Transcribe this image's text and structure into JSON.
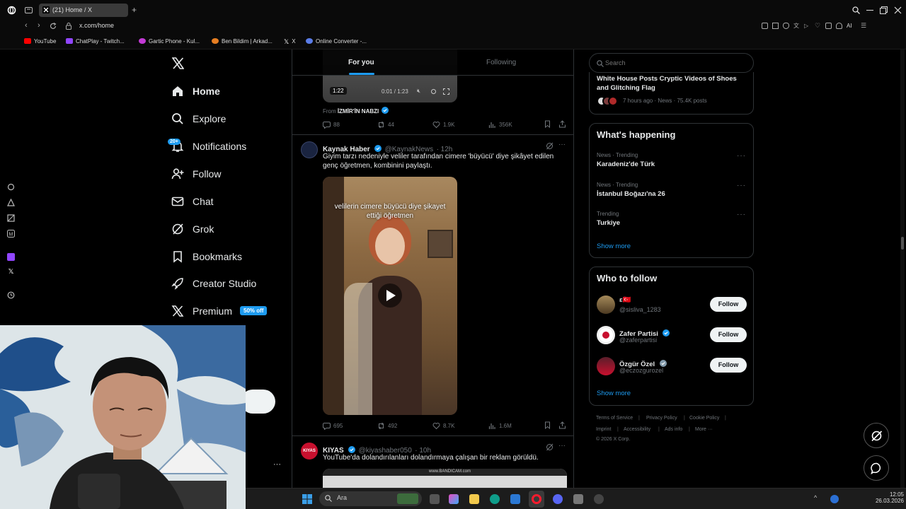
{
  "browser": {
    "tab_title": "(21) Home / X",
    "url": "x.com/home",
    "bookmarks": [
      "YouTube",
      "ChatPlay - Twitch...",
      "Gartic Phone - Kul...",
      "Ben Bildim | Arkad...",
      "X",
      "Online Converter -..."
    ]
  },
  "nav": {
    "items": [
      {
        "label": "Home",
        "icon": "home-icon"
      },
      {
        "label": "Explore",
        "icon": "search-icon"
      },
      {
        "label": "Notifications",
        "icon": "bell-icon",
        "badge": "20+"
      },
      {
        "label": "Follow",
        "icon": "add-person-icon"
      },
      {
        "label": "Chat",
        "icon": "envelope-icon"
      },
      {
        "label": "Grok",
        "icon": "grok-icon"
      },
      {
        "label": "Bookmarks",
        "icon": "bookmark-icon"
      },
      {
        "label": "Creator Studio",
        "icon": "rocket-icon"
      },
      {
        "label": "Premium",
        "icon": "x-logo-icon",
        "badge": "50% off"
      }
    ],
    "more": "···"
  },
  "feed": {
    "tabs": [
      "For you",
      "Following"
    ],
    "post1": {
      "video_duration": "1:22",
      "video_progress": "0:01 / 1:23",
      "from_label": "From",
      "from_source": "İZMİR'İN NABZI",
      "replies": "88",
      "reposts": "44",
      "likes": "1.9K",
      "views": "356K"
    },
    "post2": {
      "name": "Kaynak Haber",
      "handle": "@KaynakNews",
      "time": "· 12h",
      "text": "Giyim tarzı nedeniyle veliler tarafından cimere 'büyücü' diye şikâyet edilen genç öğretmen, kombinini paylaştı.",
      "video_caption": "velilerin cimere büyücü diye şikayet ettiği öğretmen",
      "replies": "695",
      "reposts": "492",
      "likes": "8.7K",
      "views": "1.6M"
    },
    "post3": {
      "name": "KIYAS",
      "avatar_text": "KIYAS",
      "handle": "@kiyashaber050",
      "time": "· 10h",
      "text": "YouTube'da dolandırılanları dolandırmaya çalışan bir reklam görüldü.",
      "image_text": "www.BANDICAM.com"
    }
  },
  "sidebar": {
    "search_placeholder": "Search",
    "top_news": {
      "title": "White House Posts Cryptic Videos of Shoes and Glitching Flag",
      "meta": "7 hours ago · News · 75.4K posts"
    },
    "happening": {
      "title": "What's happening",
      "trends": [
        {
          "meta": "News · Trending",
          "name": "Karadeniz'de Türk"
        },
        {
          "meta": "News · Trending",
          "name": "İstanbul Boğazı'na 26"
        },
        {
          "meta": "Trending",
          "name": "Turkiye"
        }
      ],
      "show_more": "Show more"
    },
    "who_to_follow": {
      "title": "Who to follow",
      "accounts": [
        {
          "name": "ε🇹🇷",
          "handle": "@sisliva_1283",
          "button": "Follow"
        },
        {
          "name": "Zafer Partisi",
          "handle": "@zaferpartisi",
          "button": "Follow"
        },
        {
          "name": "Özgür Özel",
          "handle": "@eczozgurozel",
          "button": "Follow"
        }
      ],
      "show_more": "Show more"
    },
    "footer": {
      "links": [
        "Terms of Service",
        "Privacy Policy",
        "Cookie Policy",
        "Imprint",
        "Accessibility",
        "Ads info",
        "More ···"
      ],
      "copyright": "© 2026 X Corp."
    }
  },
  "taskbar": {
    "search_label": "Ara",
    "time": "12:05",
    "date": "26.03.2026"
  },
  "colors": {
    "accent": "#1d9bf0",
    "background": "#000000",
    "border": "#2f3336",
    "muted": "#71767b"
  }
}
